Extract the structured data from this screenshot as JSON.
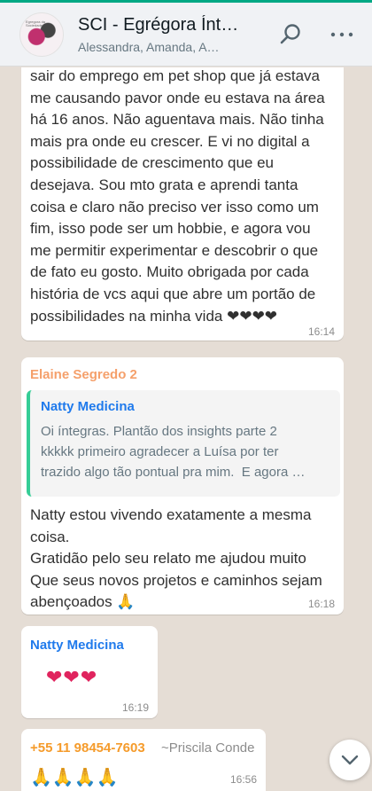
{
  "header": {
    "title": "SCI - Egrégora Ínte…",
    "subtitle": "Alessandra, Amanda, A…",
    "avatar_caption": "Egregora da Sociedade"
  },
  "messages": [
    {
      "text": "sair do emprego em pet shop que já estava\nme causando pavor onde eu estava na área\nhá 16 anos. Não aguentava mais. Não tinha\nmais pra onde eu crescer. E vi no digital a\npossibilidade de crescimento que eu\ndesejava. Sou mto grata e aprendi tanta\ncoisa e claro não preciso ver isso como um\nfim, isso pode ser um hobbie, e agora vou\nme permitir experimentar e descobrir o que\nde fato eu gosto. Muito obrigada por cada\nhistória de vcs aqui que abre um portão de\npossibilidades na minha vida ❤❤❤❤",
      "time": "16:14"
    },
    {
      "sender": "Elaine Segredo 2",
      "sender_color": "#f5a06b",
      "quote": {
        "sender": "Natty Medicina",
        "text": "Oi íntegras. Plantão dos insights parte 2\nkkkkk primeiro agradecer a Luísa por ter\ntrazido algo tão pontual pra mim.  E agora …"
      },
      "text": "Natty estou vivendo exatamente a mesma\ncoisa.\nGratidão pelo seu relato me ajudou muito\nQue seus novos projetos e caminhos sejam\nabençoados 🙏",
      "time": "16:18"
    },
    {
      "sender": "Natty Medicina",
      "sender_color": "#1f7aec",
      "text": "❤❤❤",
      "time": "16:19"
    },
    {
      "sender": "+55 11 98454-7603",
      "sender_color": "#f59b2b",
      "push_name": "~Priscila Conde",
      "text": "🙏🙏🙏🙏",
      "time": "16:56"
    }
  ],
  "colors": {
    "chat_bg": "#e5ddd5",
    "bubble_bg": "#ffffff",
    "header_bg": "#f0f2f5",
    "accent": "#00a884"
  },
  "icons": {
    "search": "search-icon",
    "menu": "more-vertical-icon",
    "scroll": "chevron-down-icon"
  }
}
